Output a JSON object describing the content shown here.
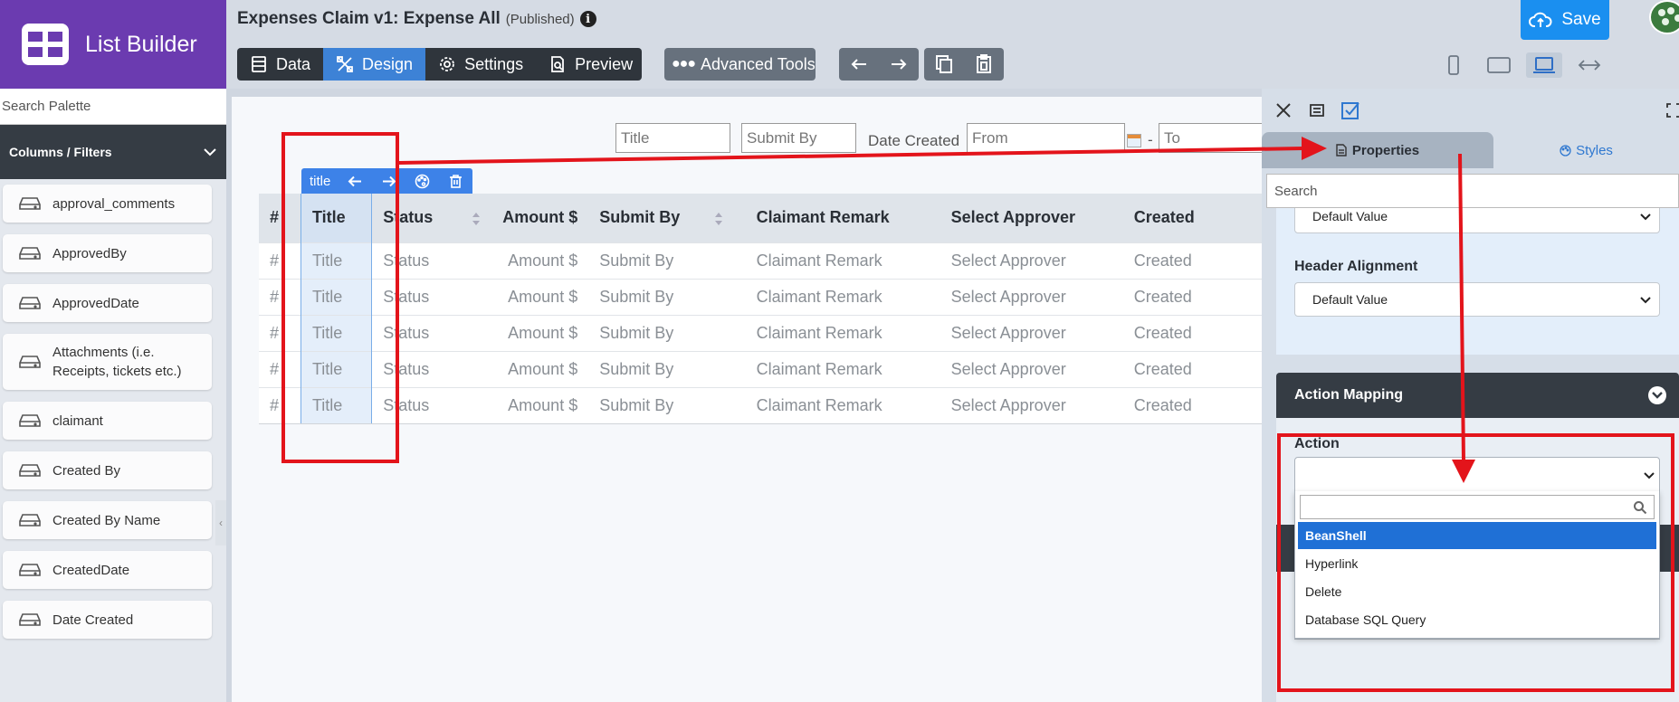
{
  "brand": {
    "name": "List Builder"
  },
  "header": {
    "title": "Expenses Claim v1: Expense All",
    "status": "(Published)",
    "info_glyph": "i",
    "tabs": [
      {
        "label": "Data",
        "icon": "table-icon"
      },
      {
        "label": "Design",
        "icon": "design-tools-icon",
        "active": true
      },
      {
        "label": "Settings",
        "icon": "gear-icon"
      },
      {
        "label": "Preview",
        "icon": "preview-icon"
      }
    ],
    "advanced_tools_label": "Advanced Tools",
    "save_label": "Save",
    "devices": [
      "phone-icon",
      "tablet-icon",
      "laptop-icon",
      "expand-width-icon"
    ],
    "active_device": "laptop-icon"
  },
  "palette": {
    "search_placeholder": "Search Palette",
    "section_title": "Columns / Filters",
    "items": [
      "approval_comments",
      "ApprovedBy",
      "ApprovedDate",
      "Attachments (i.e. Receipts, tickets etc.)",
      "claimant",
      "Created By",
      "Created By Name",
      "CreatedDate",
      "Date Created"
    ]
  },
  "filters": {
    "title_placeholder": "Title",
    "submit_by_placeholder": "Submit By",
    "date_created_label": "Date Created",
    "from_placeholder": "From",
    "to_placeholder": "To",
    "range_separator": "-"
  },
  "column_toolbar": {
    "label": "title"
  },
  "table": {
    "headers": [
      "#",
      "Title",
      "Status",
      "Amount $",
      "Submit By",
      "Claimant Remark",
      "Select Approver",
      "Created"
    ],
    "rows": [
      [
        "#",
        "Title",
        "Status",
        "Amount $",
        "Submit By",
        "Claimant Remark",
        "Select Approver",
        "Created"
      ],
      [
        "#",
        "Title",
        "Status",
        "Amount $",
        "Submit By",
        "Claimant Remark",
        "Select Approver",
        "Created"
      ],
      [
        "#",
        "Title",
        "Status",
        "Amount $",
        "Submit By",
        "Claimant Remark",
        "Select Approver",
        "Created"
      ],
      [
        "#",
        "Title",
        "Status",
        "Amount $",
        "Submit By",
        "Claimant Remark",
        "Select Approver",
        "Created"
      ],
      [
        "#",
        "Title",
        "Status",
        "Amount $",
        "Submit By",
        "Claimant Remark",
        "Select Approver",
        "Created"
      ]
    ]
  },
  "properties_panel": {
    "tabs": {
      "properties": "Properties",
      "styles": "Styles"
    },
    "search_placeholder": "Search",
    "alignment_value": "Default Value",
    "header_alignment_label": "Header Alignment",
    "header_alignment_value": "Default Value",
    "action_mapping_title": "Action Mapping",
    "action_label": "Action",
    "action_value": "",
    "dropdown_search_value": "",
    "action_options": [
      "BeanShell",
      "Hyperlink",
      "Delete",
      "Database SQL Query"
    ],
    "highlighted_option": "BeanShell"
  },
  "colors": {
    "brand": "#6b3bb0",
    "accent": "#3d82d6",
    "save": "#1a8ff0",
    "annotation": "#e3141b"
  }
}
